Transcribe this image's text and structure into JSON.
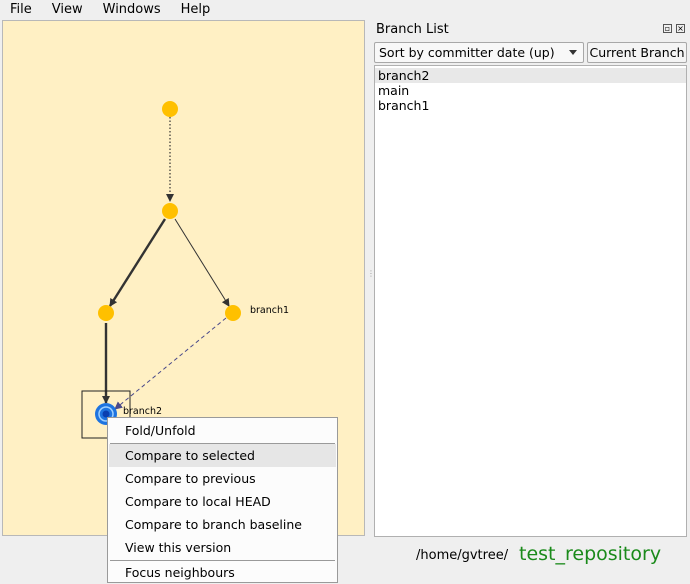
{
  "menubar": {
    "items": [
      "File",
      "View",
      "Windows",
      "Help"
    ]
  },
  "graph": {
    "nodes": [
      {
        "id": "c1",
        "label": ""
      },
      {
        "id": "c2",
        "label": ""
      },
      {
        "id": "c3",
        "label": ""
      },
      {
        "id": "c4",
        "label": "branch1"
      },
      {
        "id": "c5",
        "label": "branch2",
        "selected": true
      }
    ],
    "colors": {
      "background": "#fff0c4",
      "node": "#ffc000",
      "selected_node": "#1e74e0",
      "edge": "#333333",
      "dashed_edge": "#4a4a8a"
    }
  },
  "branch_panel": {
    "title": "Branch List",
    "sort_selected": "Sort by committer date (up)",
    "current_branch_button": "Current Branch",
    "branches": [
      "branch2",
      "main",
      "branch1"
    ],
    "selected_index": 0
  },
  "status": {
    "path": "/home/gvtree/",
    "repo_name": "test_repository",
    "repo_color": "#1a8a1a"
  },
  "context_menu": {
    "groups": [
      [
        "Fold/Unfold"
      ],
      [
        "Compare to selected",
        "Compare to previous",
        "Compare to local HEAD",
        "Compare to branch baseline",
        "View this version"
      ],
      [
        "Focus neighbours"
      ]
    ],
    "highlighted": "Compare to selected"
  }
}
